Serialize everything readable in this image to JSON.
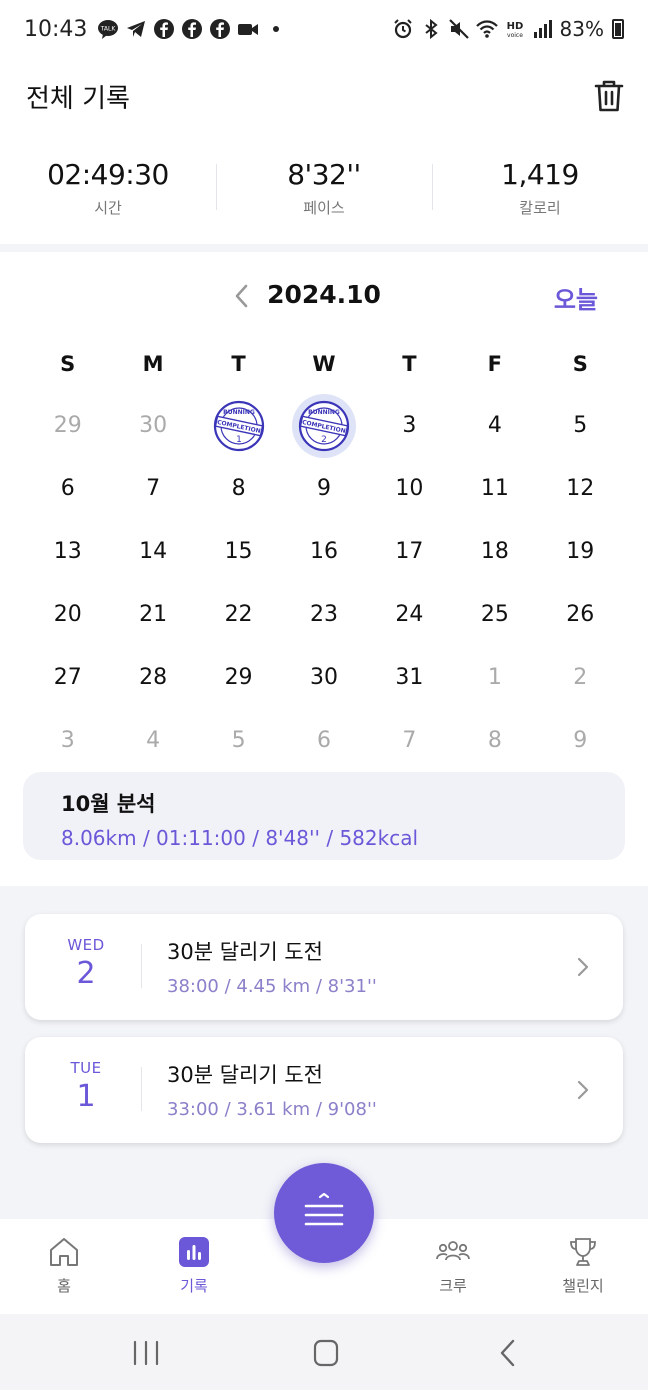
{
  "status_bar": {
    "time": "10:43",
    "battery": "83%",
    "left_icons": [
      "kakaotalk-icon",
      "telegram-icon",
      "facebook-icon",
      "facebook-icon",
      "facebook-icon",
      "video-icon",
      "dot-icon"
    ],
    "right_icons": [
      "alarm-icon",
      "bluetooth-icon",
      "mute-icon",
      "wifi-icon",
      "hd-voice-icon",
      "signal-icon",
      "battery-icon"
    ]
  },
  "header": {
    "title": "전체 기록",
    "stats": [
      {
        "value": "02:49:30",
        "label": "시간"
      },
      {
        "value": "8'32''",
        "label": "페이스"
      },
      {
        "value": "1,419",
        "label": "칼로리"
      }
    ]
  },
  "calendar": {
    "month": "2024.10",
    "today_label": "오늘",
    "weekdays": [
      "S",
      "M",
      "T",
      "W",
      "T",
      "F",
      "S"
    ],
    "days": [
      {
        "label": "29",
        "muted": true
      },
      {
        "label": "30",
        "muted": true
      },
      {
        "label": "1",
        "stamp": true
      },
      {
        "label": "2",
        "stamp": true,
        "selected": true
      },
      {
        "label": "3"
      },
      {
        "label": "4"
      },
      {
        "label": "5"
      },
      {
        "label": "6"
      },
      {
        "label": "7"
      },
      {
        "label": "8"
      },
      {
        "label": "9"
      },
      {
        "label": "10"
      },
      {
        "label": "11"
      },
      {
        "label": "12"
      },
      {
        "label": "13"
      },
      {
        "label": "14"
      },
      {
        "label": "15"
      },
      {
        "label": "16"
      },
      {
        "label": "17"
      },
      {
        "label": "18"
      },
      {
        "label": "19"
      },
      {
        "label": "20"
      },
      {
        "label": "21"
      },
      {
        "label": "22"
      },
      {
        "label": "23"
      },
      {
        "label": "24"
      },
      {
        "label": "25"
      },
      {
        "label": "26"
      },
      {
        "label": "27"
      },
      {
        "label": "28"
      },
      {
        "label": "29"
      },
      {
        "label": "30"
      },
      {
        "label": "31"
      },
      {
        "label": "1",
        "muted": true
      },
      {
        "label": "2",
        "muted": true
      },
      {
        "label": "3",
        "muted": true
      },
      {
        "label": "4",
        "muted": true
      },
      {
        "label": "5",
        "muted": true
      },
      {
        "label": "6",
        "muted": true
      },
      {
        "label": "7",
        "muted": true
      },
      {
        "label": "8",
        "muted": true
      },
      {
        "label": "9",
        "muted": true
      }
    ],
    "stamp_text": {
      "top": "RUNNING",
      "bottom": "COMPLETION"
    },
    "analysis": {
      "title": "10월 분석",
      "summary": "8.06km / 01:11:00 / 8'48'' / 582kcal"
    }
  },
  "records": [
    {
      "dow": "WED",
      "day": "2",
      "title": "30분 달리기 도전",
      "detail": "38:00 / 4.45 km / 8'31''"
    },
    {
      "dow": "TUE",
      "day": "1",
      "title": "30분 달리기 도전",
      "detail": "33:00 / 3.61 km / 9'08''"
    }
  ],
  "bottom_nav": {
    "items": [
      {
        "label": "홈",
        "icon": "home-icon"
      },
      {
        "label": "기록",
        "icon": "chart-icon",
        "active": true
      },
      {
        "label": "크루",
        "icon": "crew-icon"
      },
      {
        "label": "챌린지",
        "icon": "trophy-icon"
      }
    ],
    "fab_icon": "menu-icon"
  },
  "colors": {
    "accent": "#6a58d8",
    "stamp": "#3b35b8",
    "selected_bg": "#dfe3f8",
    "muted_text": "#aaaaaa"
  }
}
